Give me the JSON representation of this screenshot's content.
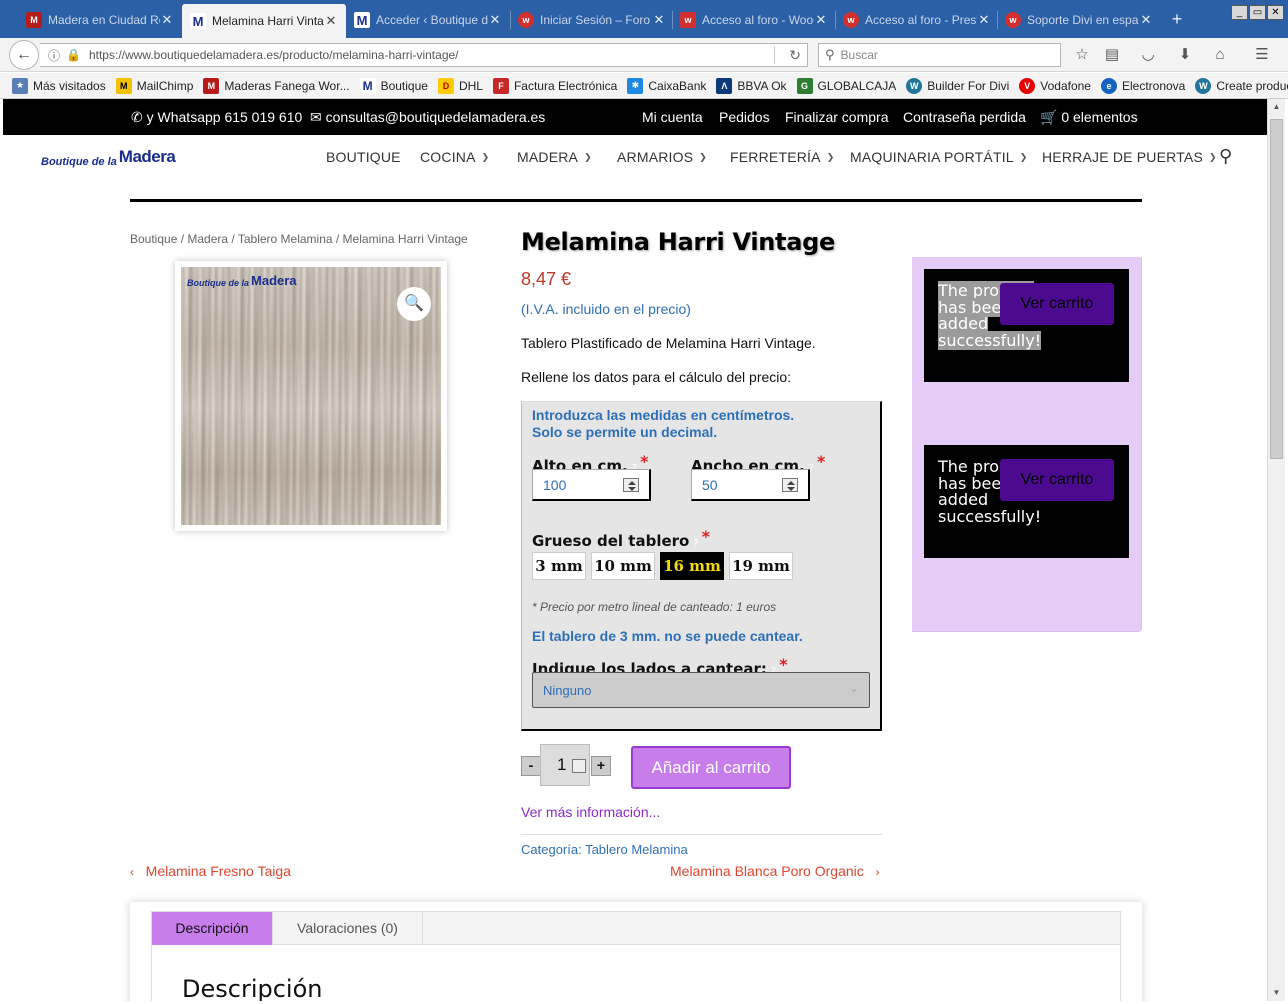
{
  "browser": {
    "tabs": [
      {
        "label": "Madera en Ciudad Real",
        "icon": "maderas-favicon",
        "color": "#b71c1c",
        "active": false
      },
      {
        "label": "Melamina Harri Vintage",
        "icon": "boutique-favicon",
        "color": "#1b2e8f",
        "active": true
      },
      {
        "label": "Acceder ‹ Boutique de la Madera",
        "icon": "boutique-favicon",
        "color": "#1b2e8f",
        "active": false
      },
      {
        "label": "Iniciar Sesión – Foro",
        "icon": "woo-favicon",
        "color": "#d32f2f",
        "active": false
      },
      {
        "label": "Acceso al foro - WooCommerce",
        "icon": "woo-favicon",
        "color": "#d32f2f",
        "active": false
      },
      {
        "label": "Acceso al foro - Prestashop",
        "icon": "woo-favicon",
        "color": "#d32f2f",
        "active": false
      },
      {
        "label": "Soporte Divi en español",
        "icon": "woo-favicon",
        "color": "#d32f2f",
        "active": false
      }
    ],
    "new_tab": "+",
    "window_buttons": [
      "_",
      "▭",
      "✕"
    ],
    "url": "https://www.boutiquedelamadera.es/producto/melamina-harri-vintage/",
    "search_placeholder": "Buscar",
    "bookmarks": [
      {
        "label": "Más visitados",
        "icon": "most-visited-icon",
        "color": "#5b7fb5"
      },
      {
        "label": "MailChimp",
        "icon": "mailchimp-icon",
        "color": "#f3c200"
      },
      {
        "label": "Maderas Fanega Wor...",
        "icon": "maderas-favicon",
        "color": "#b71c1c"
      },
      {
        "label": "Boutique",
        "icon": "boutique-favicon",
        "color": "#1b2e8f"
      },
      {
        "label": "DHL",
        "icon": "dhl-icon",
        "color": "#ffcc00"
      },
      {
        "label": "Factura Electrónica",
        "icon": "factura-icon",
        "color": "#c62828"
      },
      {
        "label": "CaixaBank",
        "icon": "caixabank-icon",
        "color": "#1e88e5"
      },
      {
        "label": "BBVA Ok",
        "icon": "bbva-icon",
        "color": "#0d3b7a"
      },
      {
        "label": "GLOBALCAJA",
        "icon": "globalcaja-icon",
        "color": "#2e7d32"
      },
      {
        "label": "Builder For Divi",
        "icon": "wordpress-icon",
        "color": "#21759b"
      },
      {
        "label": "Vodafone",
        "icon": "vodafone-icon",
        "color": "#e60000"
      },
      {
        "label": "Electronova",
        "icon": "electronova-icon",
        "color": "#1565c0"
      },
      {
        "label": "Create product like on ...",
        "icon": "wordpress-icon",
        "color": "#21759b"
      }
    ]
  },
  "topbar": {
    "whatsapp": "y Whatsapp 615 019 610",
    "email": "consultas@boutiquedelamadera.es",
    "links": [
      "Mi cuenta",
      "Pedidos",
      "Finalizar compra",
      "Contraseña perdida"
    ],
    "cart": "0 elementos"
  },
  "header": {
    "logo_small": "Boutique de la",
    "logo_big": "Madera",
    "menu": [
      {
        "label": "BOUTIQUE",
        "dropdown": false
      },
      {
        "label": "COCINA",
        "dropdown": true
      },
      {
        "label": "MADERA",
        "dropdown": true
      },
      {
        "label": "ARMARIOS",
        "dropdown": true
      },
      {
        "label": "FERRETERÍA",
        "dropdown": true
      },
      {
        "label": "MAQUINARIA PORTÁTIL",
        "dropdown": true
      },
      {
        "label": "HERRAJE DE PUERTAS",
        "dropdown": true
      }
    ]
  },
  "breadcrumb": "Boutique / Madera / Tablero Melamina / Melamina Harri Vintage",
  "product": {
    "title": "Melamina Harri Vintage",
    "price": "8,47 €",
    "tax_note": "(I.V.A. incluido en el precio)",
    "description": "Tablero Plastificado de Melamina Harri Vintage.",
    "fill_prompt": "Rellene los datos para el cálculo del precio:",
    "image_logo_small": "Boutique de la",
    "image_logo_big": "Madera"
  },
  "calculator": {
    "info_line1": "Introduzca las medidas en centímetros.",
    "info_line2": "Solo se permite un decimal.",
    "alto_label": "Alto en cm.",
    "alto_value": "100",
    "ancho_label": "Ancho en cm.",
    "ancho_value": "50",
    "help": "?",
    "required": "*",
    "grueso_label": "Grueso del tablero",
    "thickness_options": [
      "3 mm",
      "10 mm",
      "16 mm",
      "19 mm"
    ],
    "thickness_selected": "16 mm",
    "edge_note": "* Precio por metro lineal de canteado: 1 euros",
    "warning": "El tablero de 3 mm. no se puede cantear.",
    "sides_label": "Indique los lados a cantear:",
    "sides_value": "Ninguno"
  },
  "cart": {
    "minus": "-",
    "plus": "+",
    "quantity": "1",
    "add_button": "Añadir al carrito"
  },
  "more_info": "Ver más información...",
  "category": "Categoría: Tablero Melamina",
  "prev_link": "Melamina Fresno Taiga",
  "next_link": "Melamina Blanca Poro Organic",
  "notices": [
    {
      "text": "The product has been added successfully!",
      "button": "Ver carrito"
    },
    {
      "text": "The product has been added successfully!",
      "button": "Ver carrito"
    }
  ],
  "tabs": {
    "items": [
      "Descripción",
      "Valoraciones (0)"
    ],
    "active": "Descripción",
    "heading": "Descripción"
  },
  "colors": {
    "accent": "#c77dea",
    "price": "#c0392b",
    "link_blue": "#2e6fb7",
    "nav_link": "#e2452f",
    "notice_button": "#4b0a8f"
  }
}
